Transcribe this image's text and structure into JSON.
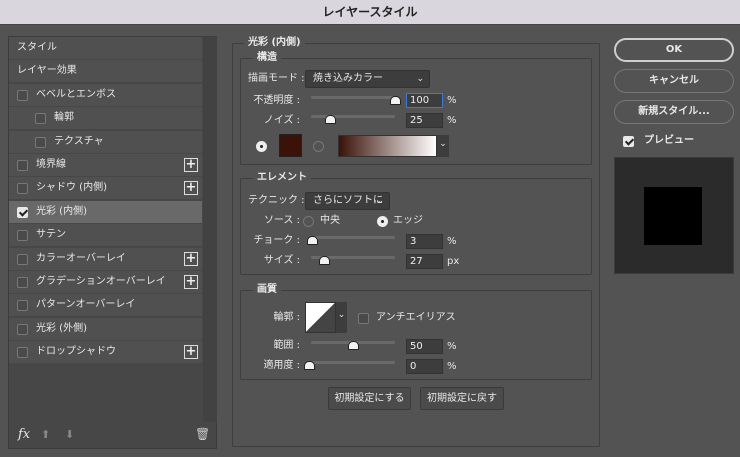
{
  "window": {
    "title": "レイヤースタイル"
  },
  "sidebar": {
    "items": [
      {
        "label": "スタイル",
        "checkbox": false,
        "checked": false,
        "plus": false,
        "indent": 0
      },
      {
        "label": "レイヤー効果",
        "checkbox": false,
        "checked": false,
        "plus": false,
        "indent": 0
      },
      {
        "label": "ベベルとエンボス",
        "checkbox": true,
        "checked": false,
        "plus": false,
        "indent": 0
      },
      {
        "label": "輪郭",
        "checkbox": true,
        "checked": false,
        "plus": false,
        "indent": 1
      },
      {
        "label": "テクスチャ",
        "checkbox": true,
        "checked": false,
        "plus": false,
        "indent": 1
      },
      {
        "label": "境界線",
        "checkbox": true,
        "checked": false,
        "plus": true,
        "indent": 0
      },
      {
        "label": "シャドウ (内側)",
        "checkbox": true,
        "checked": false,
        "plus": true,
        "indent": 0
      },
      {
        "label": "光彩 (内側)",
        "checkbox": true,
        "checked": true,
        "plus": false,
        "indent": 0,
        "selected": true
      },
      {
        "label": "サテン",
        "checkbox": true,
        "checked": false,
        "plus": false,
        "indent": 0
      },
      {
        "label": "カラーオーバーレイ",
        "checkbox": true,
        "checked": false,
        "plus": true,
        "indent": 0
      },
      {
        "label": "グラデーションオーバーレイ",
        "checkbox": true,
        "checked": false,
        "plus": true,
        "indent": 0
      },
      {
        "label": "パターンオーバーレイ",
        "checkbox": true,
        "checked": false,
        "plus": false,
        "indent": 0
      },
      {
        "label": "光彩 (外側)",
        "checkbox": true,
        "checked": false,
        "plus": false,
        "indent": 0
      },
      {
        "label": "ドロップシャドウ",
        "checkbox": true,
        "checked": false,
        "plus": true,
        "indent": 0
      }
    ],
    "fx_label": "fx"
  },
  "main": {
    "title": "光彩 (内側)",
    "structure": {
      "legend": "構造",
      "blend_label": "描画モード :",
      "blend_value": "焼き込みカラー",
      "opacity_label": "不透明度 :",
      "opacity": "100",
      "opacity_unit": "%",
      "noise_label": "ノイズ :",
      "noise": "25",
      "noise_unit": "%",
      "color": "#3a1208"
    },
    "elements": {
      "legend": "エレメント",
      "technique_label": "テクニック :",
      "technique_value": "さらにソフトに",
      "source_label": "ソース :",
      "source_center": "中央",
      "source_edge": "エッジ",
      "choke_label": "チョーク :",
      "choke": "3",
      "choke_unit": "%",
      "size_label": "サイズ :",
      "size": "27",
      "size_unit": "px"
    },
    "quality": {
      "legend": "画質",
      "contour_label": "輪郭 :",
      "antialias_label": "アンチエイリアス",
      "antialias_checked": false,
      "range_label": "範囲 :",
      "range": "50",
      "range_unit": "%",
      "jitter_label": "適用度 :",
      "jitter": "0",
      "jitter_unit": "%"
    },
    "make_default": "初期設定にする",
    "reset_default": "初期設定に戻す"
  },
  "actions": {
    "ok": "OK",
    "cancel": "キャンセル",
    "new_style": "新規スタイル...",
    "preview_label": "プレビュー",
    "preview_checked": true
  }
}
